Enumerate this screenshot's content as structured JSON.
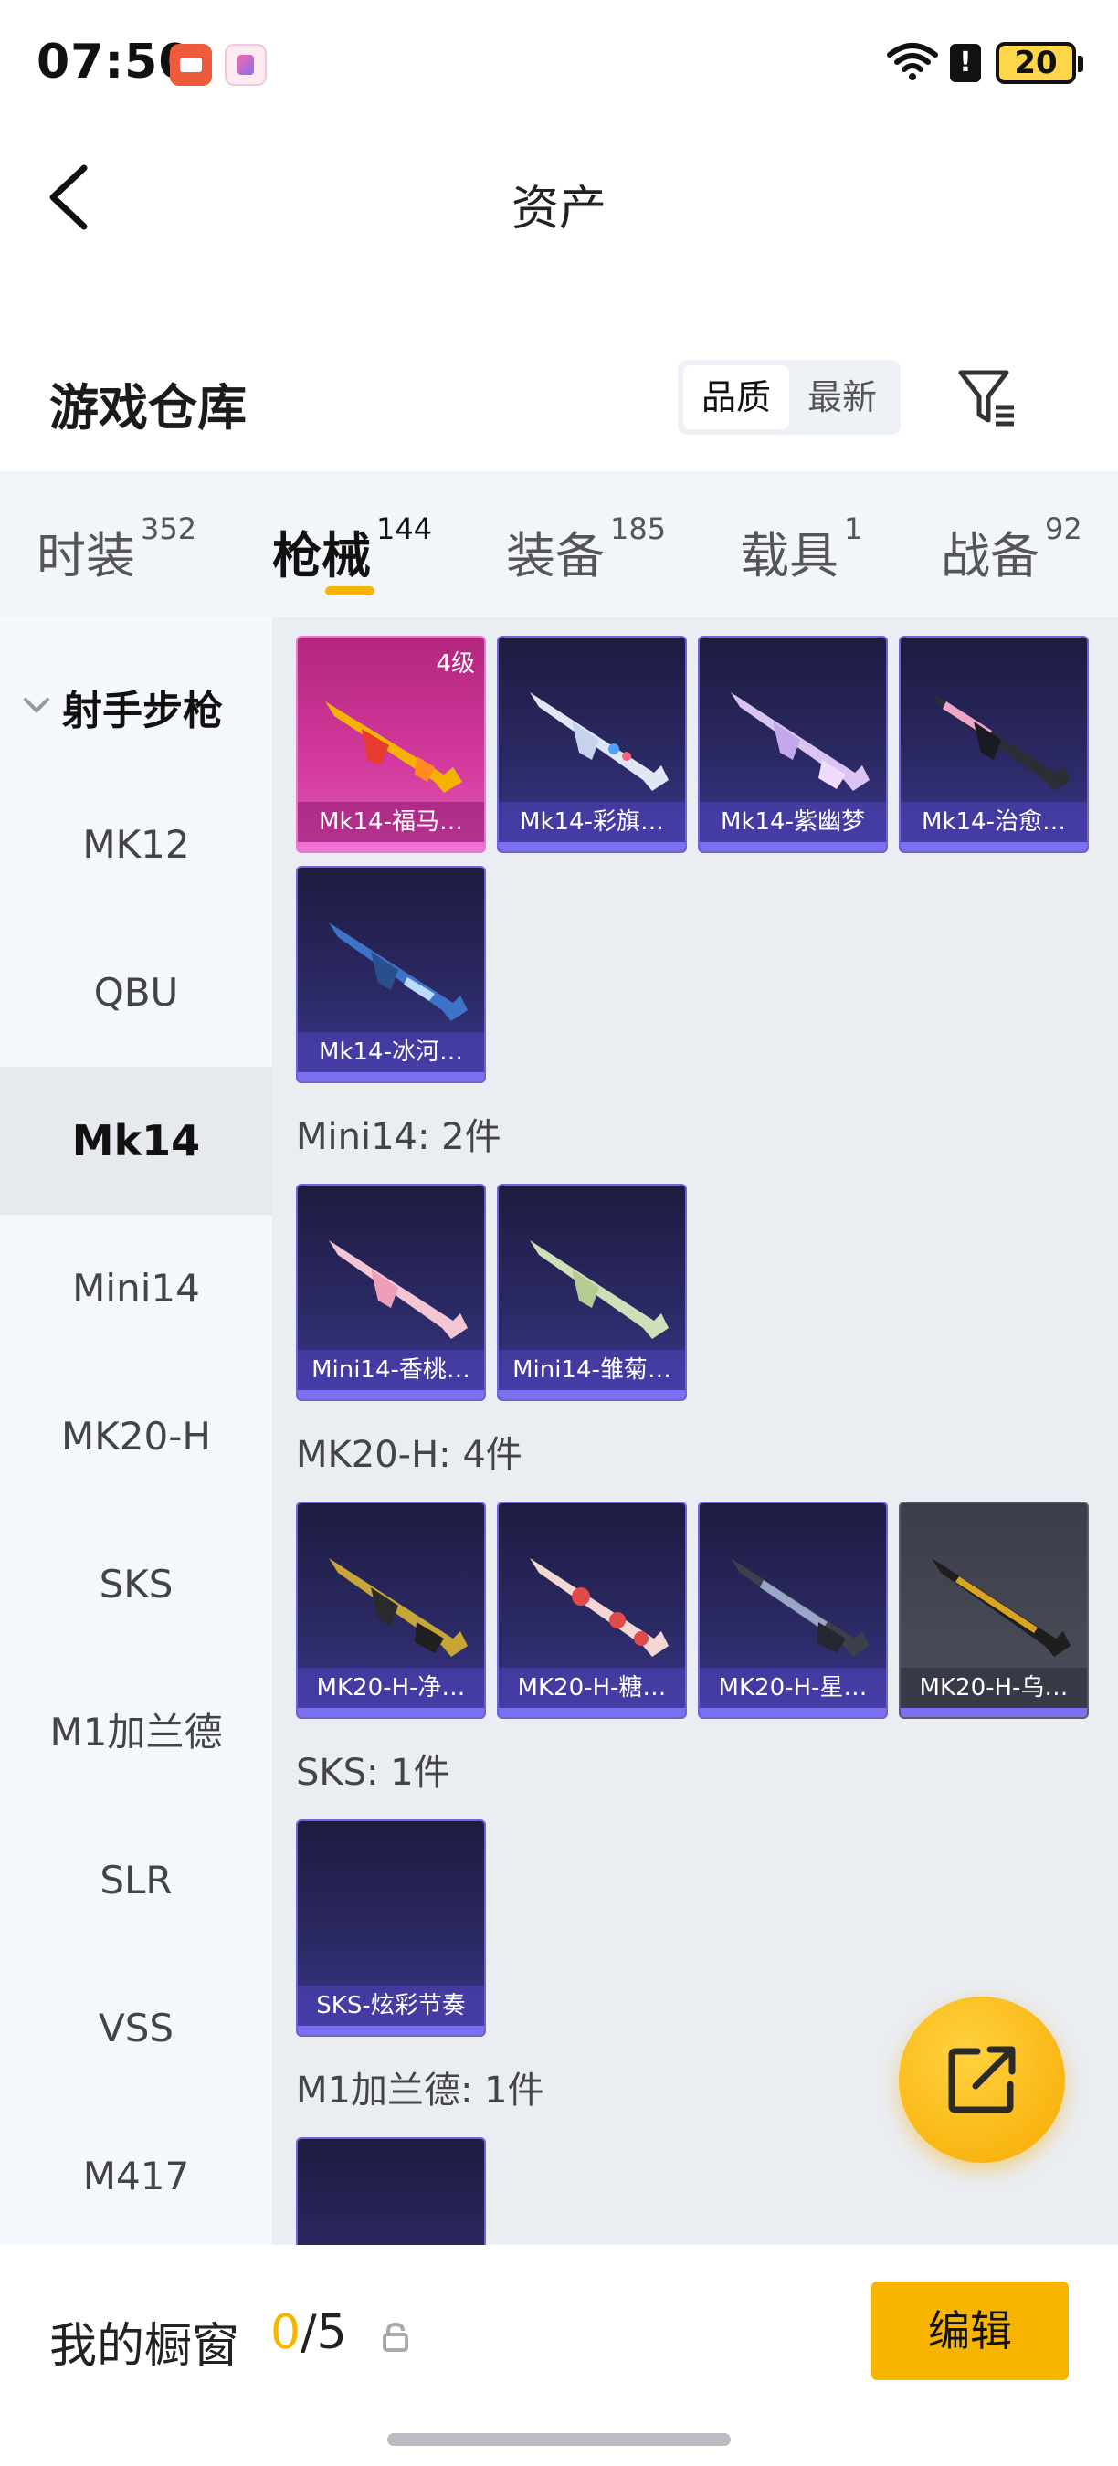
{
  "status_bar": {
    "time": "07:50",
    "battery": "20",
    "alert": "!"
  },
  "header": {
    "title": "资产"
  },
  "warehouse": {
    "title": "游戏仓库",
    "sort_options": [
      "品质",
      "最新"
    ],
    "selected_sort": "品质"
  },
  "tabs": [
    {
      "label": "时装",
      "count": "352"
    },
    {
      "label": "枪械",
      "count": "144",
      "active": true
    },
    {
      "label": "装备",
      "count": "185"
    },
    {
      "label": "载具",
      "count": "1"
    },
    {
      "label": "战备",
      "count": "92"
    }
  ],
  "sidebar": {
    "group": "射手步枪",
    "items": [
      "MK12",
      "QBU",
      "Mk14",
      "Mini14",
      "MK20-H",
      "SKS",
      "M1加兰德",
      "SLR",
      "VSS",
      "M417"
    ],
    "active": "Mk14"
  },
  "groups": [
    {
      "heading": "",
      "items": [
        {
          "label": "Mk14-福马…",
          "level": "4级"
        },
        {
          "label": "Mk14-彩旗…"
        },
        {
          "label": "Mk14-紫幽梦"
        },
        {
          "label": "Mk14-治愈…"
        },
        {
          "label": "Mk14-冰河…"
        }
      ]
    },
    {
      "heading": "Mini14: 2件",
      "items": [
        {
          "label": "Mini14-香桃…"
        },
        {
          "label": "Mini14-雏菊…"
        }
      ]
    },
    {
      "heading": "MK20-H: 4件",
      "items": [
        {
          "label": "MK20-H-净…"
        },
        {
          "label": "MK20-H-糖…"
        },
        {
          "label": "MK20-H-星…"
        },
        {
          "label": "MK20-H-乌…"
        }
      ]
    },
    {
      "heading": "SKS: 1件",
      "items": [
        {
          "label": "SKS-炫彩节奏"
        }
      ]
    },
    {
      "heading": "M1加兰德: 1件",
      "items": []
    }
  ],
  "bottom_bar": {
    "label": "我的橱窗",
    "current": "0",
    "total": "/5",
    "edit_label": "编辑"
  },
  "colors": {
    "accent": "#f7b500",
    "card_purple": "#2c2a66",
    "card_pink": "#d43a9e"
  }
}
